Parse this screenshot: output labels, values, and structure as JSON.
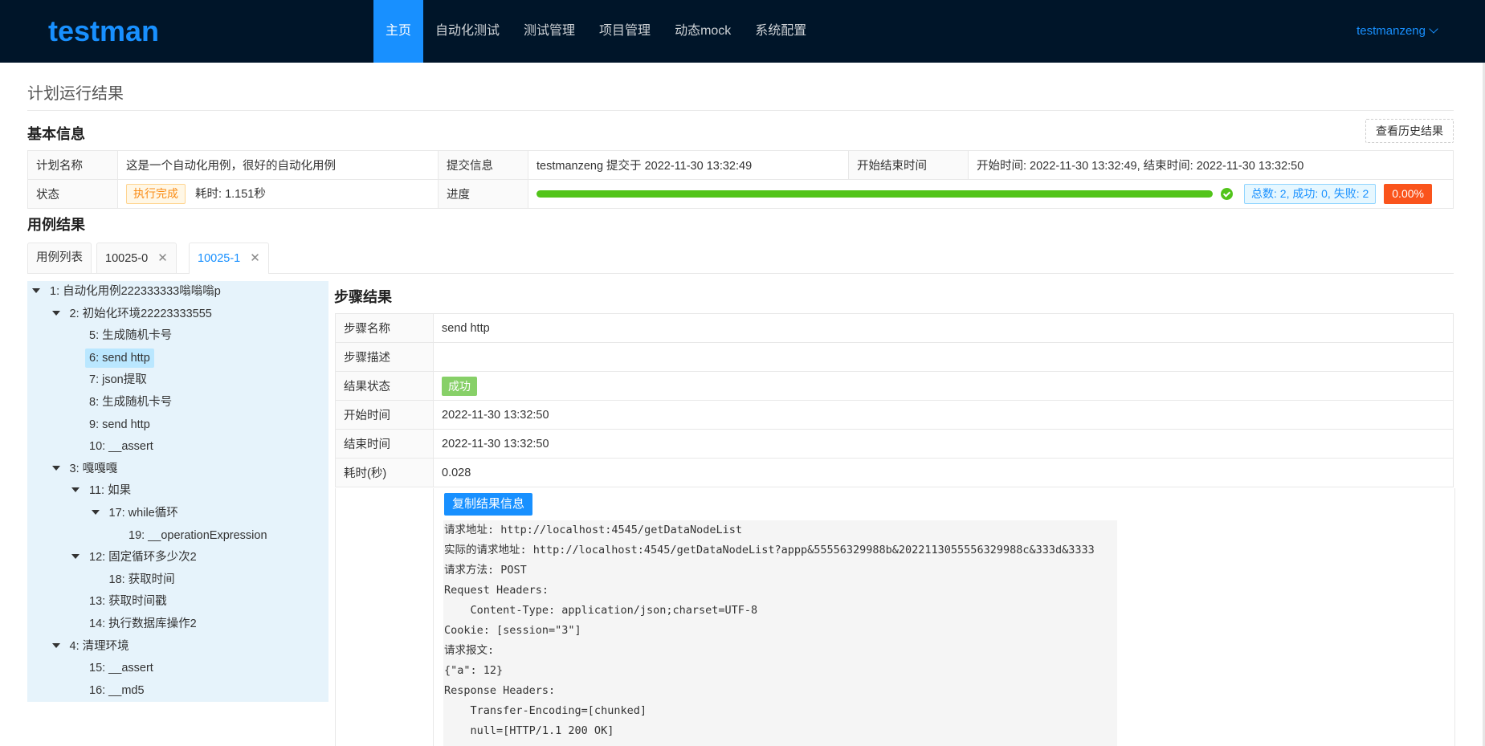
{
  "app": {
    "logo": "testman",
    "user": "testmanzeng"
  },
  "nav": [
    "主页",
    "自动化测试",
    "测试管理",
    "项目管理",
    "动态mock",
    "系统配置"
  ],
  "page": {
    "title": "计划运行结果"
  },
  "basic": {
    "heading": "基本信息",
    "history_button": "查看历史结果",
    "plan_name_label": "计划名称",
    "plan_name": "这是一个自动化用例，很好的自动化用例",
    "submit_label": "提交信息",
    "submit_value": "testmanzeng 提交于 2022-11-30 13:32:49",
    "time_label": "开始结束时间",
    "time_value": "开始时间: 2022-11-30 13:32:49, 结束时间: 2022-11-30 13:32:50",
    "status_label": "状态",
    "status_tag": "执行完成",
    "duration": "耗时: 1.151秒",
    "progress_label": "进度",
    "progress_percent": 100,
    "summary_tag": "总数: 2, 成功: 0, 失败: 2",
    "fail_rate": "0.00%"
  },
  "cases": {
    "heading": "用例结果",
    "tabs": [
      "用例列表",
      "10025-0",
      "10025-1"
    ],
    "active_tab": "10025-1"
  },
  "tree": [
    {
      "label": "1: 自动化用例222333333嗡嗡嗡p",
      "depth": 0,
      "expanded": true
    },
    {
      "label": "2: 初始化环境22223333555",
      "depth": 1,
      "expanded": true
    },
    {
      "label": "5: 生成随机卡号",
      "depth": 2
    },
    {
      "label": "6: send http",
      "depth": 2,
      "selected": true
    },
    {
      "label": "7: json提取",
      "depth": 2
    },
    {
      "label": "8: 生成随机卡号",
      "depth": 2
    },
    {
      "label": "9: send http",
      "depth": 2
    },
    {
      "label": "10: __assert",
      "depth": 2
    },
    {
      "label": "3: 嘎嘎嘎",
      "depth": 1,
      "expanded": true
    },
    {
      "label": "11: 如果",
      "depth": 2,
      "expanded": true
    },
    {
      "label": "17: while循环",
      "depth": 3,
      "expanded": true
    },
    {
      "label": "19: __operationExpression",
      "depth": 4
    },
    {
      "label": "12: 固定循环多少次2",
      "depth": 2,
      "expanded": true
    },
    {
      "label": "18: 获取时间",
      "depth": 3
    },
    {
      "label": "13: 获取时间戳",
      "depth": 2
    },
    {
      "label": "14: 执行数据库操作2",
      "depth": 2
    },
    {
      "label": "4: 清理环境",
      "depth": 1,
      "expanded": true
    },
    {
      "label": "15: __assert",
      "depth": 2
    },
    {
      "label": "16: __md5",
      "depth": 2
    }
  ],
  "step": {
    "heading": "步骤结果",
    "rows": [
      {
        "label": "步骤名称",
        "value": "send http"
      },
      {
        "label": "步骤描述",
        "value": ""
      },
      {
        "label": "结果状态",
        "value": "成功",
        "is_tag": true
      },
      {
        "label": "开始时间",
        "value": "2022-11-30 13:32:50"
      },
      {
        "label": "结束时间",
        "value": "2022-11-30 13:32:50"
      },
      {
        "label": "耗时(秒)",
        "value": "0.028"
      }
    ],
    "copy_button": "复制结果信息",
    "log": [
      "请求地址: http://localhost:4545/getDataNodeList",
      "实际的请求地址: http://localhost:4545/getDataNodeList?appp&55556329988b&2022113055556329988c&333d&3333",
      "请求方法: POST",
      "Request Headers:",
      "    Content-Type: application/json;charset=UTF-8",
      "Cookie: [session=\"3\"]",
      "请求报文:",
      "{\"a\": 12}",
      "Response Headers:",
      "    Transfer-Encoding=[chunked]",
      "    null=[HTTP/1.1 200 OK]"
    ]
  },
  "colors": {
    "nav_bg": "#001529",
    "primary": "#1890ff",
    "success": "#52c41a",
    "tree_bg": "#e6f3fb",
    "danger": "#fa541c"
  }
}
